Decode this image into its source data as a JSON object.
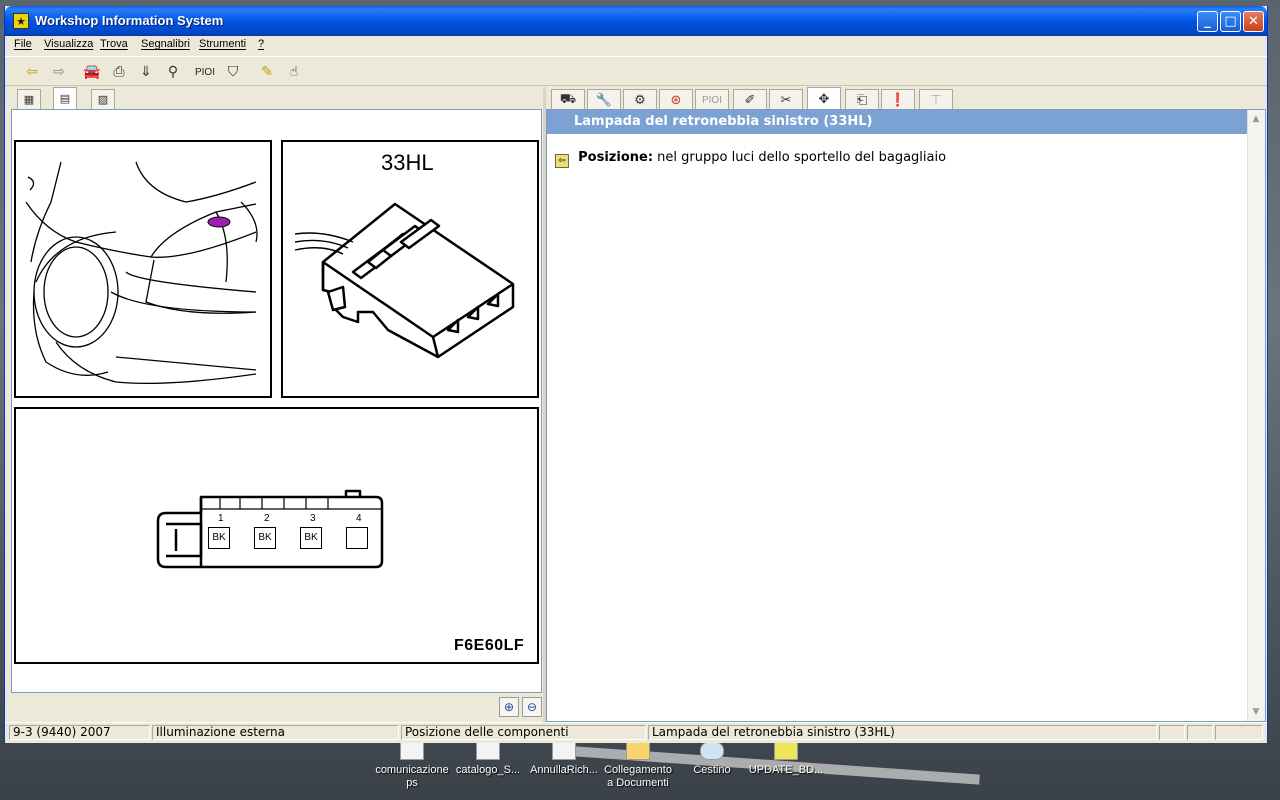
{
  "window": {
    "title": "Workshop Information System",
    "minimize": "_",
    "maximize": "□",
    "close": "✕"
  },
  "menu": {
    "items": [
      "File",
      "Visualizza",
      "Trova",
      "Segnalibri",
      "Strumenti",
      "?"
    ]
  },
  "toolbar": {
    "icons": [
      "back-arrow-icon",
      "forward-arrow-icon",
      "car-icon",
      "print-icon",
      "export-icon",
      "binoculars-icon",
      "pioi-label",
      "filter-icon",
      "highlighter-icon",
      "pointer-icon"
    ],
    "pioi_label": "PIOI"
  },
  "left_tabs": [
    "tree-icon",
    "document-icon",
    "image-icon"
  ],
  "diagram": {
    "connector_code": "33HL",
    "figure_code": "F6E60LF",
    "pins": [
      {
        "number": "1",
        "color": "BK"
      },
      {
        "number": "2",
        "color": "BK"
      },
      {
        "number": "3",
        "color": "BK"
      },
      {
        "number": "4",
        "color": ""
      }
    ]
  },
  "right_tabs": {
    "icons": [
      "car-front-icon",
      "wrench-icon",
      "gears-icon",
      "alarm-icon",
      "pioi-label",
      "tools-icon",
      "tweezers-icon",
      "move-icon",
      "component-icon",
      "warning-icon",
      "hanger-icon"
    ],
    "pioi_label": "PIOI"
  },
  "component": {
    "title": "Lampada del retronebbia sinistro (33HL)",
    "position_label": "Posizione:",
    "position_value": "nel gruppo luci dello sportello del bagagliaio"
  },
  "status": {
    "model": "9-3 (9440) 2007",
    "category": "Illuminazione esterna",
    "section": "Posizione delle componenti",
    "component": "Lampada del retronebbia sinistro (33HL)"
  },
  "desktop_icons": [
    {
      "label": "comunicazione ps"
    },
    {
      "label": "catalogo_S..."
    },
    {
      "label": "AnnullaRich..."
    },
    {
      "label": "Collegamento a Documenti"
    },
    {
      "label": "Cestino"
    },
    {
      "label": "UPDATE_BD..."
    }
  ]
}
